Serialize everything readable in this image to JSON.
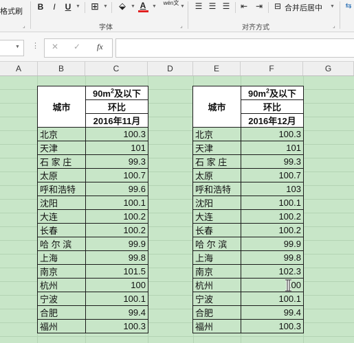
{
  "ribbon": {
    "format_painter": "格式刷",
    "bold": "B",
    "italic": "I",
    "underline": "U",
    "font_color_glyph": "A",
    "phonetic_glyph": "wén文",
    "merge_center": "合并后居中",
    "group_font": "字体",
    "group_alignment": "对齐方式"
  },
  "formula_bar": {
    "fx_label": "fx",
    "cancel_glyph": "✕",
    "confirm_glyph": "✓",
    "content": ""
  },
  "columns": [
    "A",
    "B",
    "C",
    "D",
    "E",
    "F",
    "G"
  ],
  "table_nov": {
    "header_city": "城市",
    "header_type_pre": "90m",
    "header_type_sup": "2",
    "header_type_post": "及以下",
    "header_ratio": "环比",
    "header_month": "2016年11月",
    "rows": [
      {
        "city": "北京",
        "value": "100.3"
      },
      {
        "city": "天津",
        "value": "101"
      },
      {
        "city": "石 家 庄",
        "value": "99.3"
      },
      {
        "city": "太原",
        "value": "100.7"
      },
      {
        "city": "呼和浩特",
        "value": "99.6"
      },
      {
        "city": "沈阳",
        "value": "100.1"
      },
      {
        "city": "大连",
        "value": "100.2"
      },
      {
        "city": "长春",
        "value": "100.2"
      },
      {
        "city": "哈 尔 滨",
        "value": "99.9"
      },
      {
        "city": "上海",
        "value": "99.8"
      },
      {
        "city": "南京",
        "value": "101.5"
      },
      {
        "city": "杭州",
        "value": "100"
      },
      {
        "city": "宁波",
        "value": "100.1"
      },
      {
        "city": "合肥",
        "value": "99.4"
      },
      {
        "city": "福州",
        "value": "100.3"
      }
    ]
  },
  "table_dec": {
    "header_city": "城市",
    "header_type_pre": "90m",
    "header_type_sup": "2",
    "header_type_post": "及以下",
    "header_ratio": "环比",
    "header_month": "2016年12月",
    "rows": [
      {
        "city": "北京",
        "value": "100.3"
      },
      {
        "city": "天津",
        "value": "101"
      },
      {
        "city": "石 家 庄",
        "value": "99.3"
      },
      {
        "city": "太原",
        "value": "100.7"
      },
      {
        "city": "呼和浩特",
        "value": "103"
      },
      {
        "city": "沈阳",
        "value": "100.1"
      },
      {
        "city": "大连",
        "value": "100.2"
      },
      {
        "city": "长春",
        "value": "100.2"
      },
      {
        "city": "哈 尔 滨",
        "value": "99.9"
      },
      {
        "city": "上海",
        "value": "99.8"
      },
      {
        "city": "南京",
        "value": "102.3"
      },
      {
        "city": "杭州",
        "value": "100"
      },
      {
        "city": "宁波",
        "value": "100.1"
      },
      {
        "city": "合肥",
        "value": "99.4"
      },
      {
        "city": "福州",
        "value": "100.3"
      }
    ]
  },
  "colors": {
    "sheet_background": "#c8e6c8",
    "font_color_bar": "#e02020",
    "gridline": "#b3d3b3"
  }
}
